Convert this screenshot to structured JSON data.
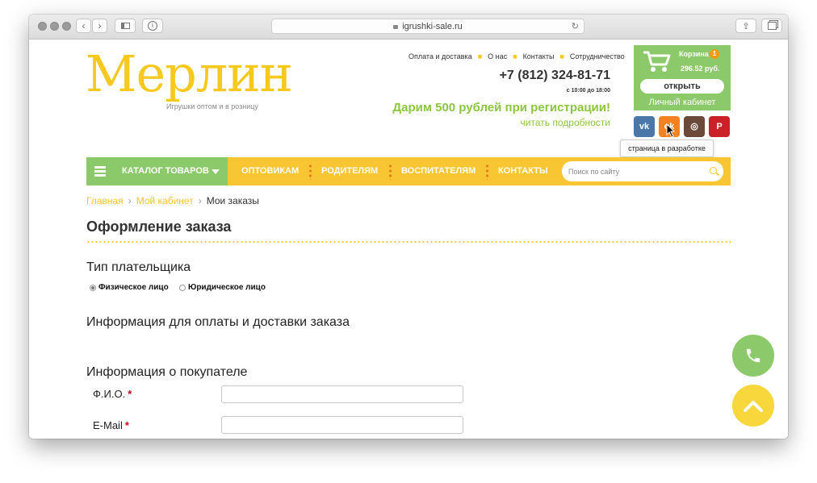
{
  "browser": {
    "url": "igrushki-sale.ru"
  },
  "header": {
    "logo": "Мерлин",
    "logo_subtitle": "Игрушки оптом и в розницу",
    "top_nav": [
      "Оплата и доставка",
      "О нас",
      "Контакты",
      "Сотрудничество"
    ],
    "phone": "+7 (812) 324-81-71",
    "hours": "с 10:00 до 18:00",
    "promo": "Дарим 500 рублей при регистрации!",
    "promo_link": "читать подробности"
  },
  "cart": {
    "label": "Корзина",
    "count": "1",
    "sum": "296.52 руб.",
    "open_button": "открыть",
    "account_link": "Личный кабинет"
  },
  "social": [
    {
      "name": "vk-icon",
      "glyph": "vk",
      "color": "#4a76a8"
    },
    {
      "name": "odnoklassniki-icon",
      "glyph": "ok",
      "color": "#f58220"
    },
    {
      "name": "instagram-icon",
      "glyph": "◎",
      "color": "#6b4a3a"
    },
    {
      "name": "pinterest-icon",
      "glyph": "P",
      "color": "#cb2027"
    }
  ],
  "tooltip": "страница в разработке",
  "nav": {
    "catalog": "КАТАЛОГ ТОВАРОВ",
    "items": [
      "ОПТОВИКАМ",
      "РОДИТЕЛЯМ",
      "ВОСПИТАТЕЛЯМ",
      "КОНТАКТЫ"
    ],
    "search_placeholder": "Поиск по сайту"
  },
  "breadcrumbs": [
    "Главная",
    "Мой кабинет",
    "Мои заказы"
  ],
  "page_title": "Оформление заказа",
  "form": {
    "payer_type_heading": "Тип плательщика",
    "payer_types": [
      "Физическое лицо",
      "Юридическое лицо"
    ],
    "payer_type_selected": "Физическое лицо",
    "payment_info_heading": "Информация для оплаты и доставки заказа",
    "buyer_info_heading": "Информация о покупателе",
    "fields": [
      {
        "label": "Ф.И.О.",
        "required": "*",
        "value": ""
      },
      {
        "label": "E-Mail",
        "required": "*",
        "value": ""
      }
    ]
  },
  "colors": {
    "brand_yellow": "#f7c632",
    "brand_green": "#8cc96a",
    "promo_green": "#8cc63f"
  }
}
